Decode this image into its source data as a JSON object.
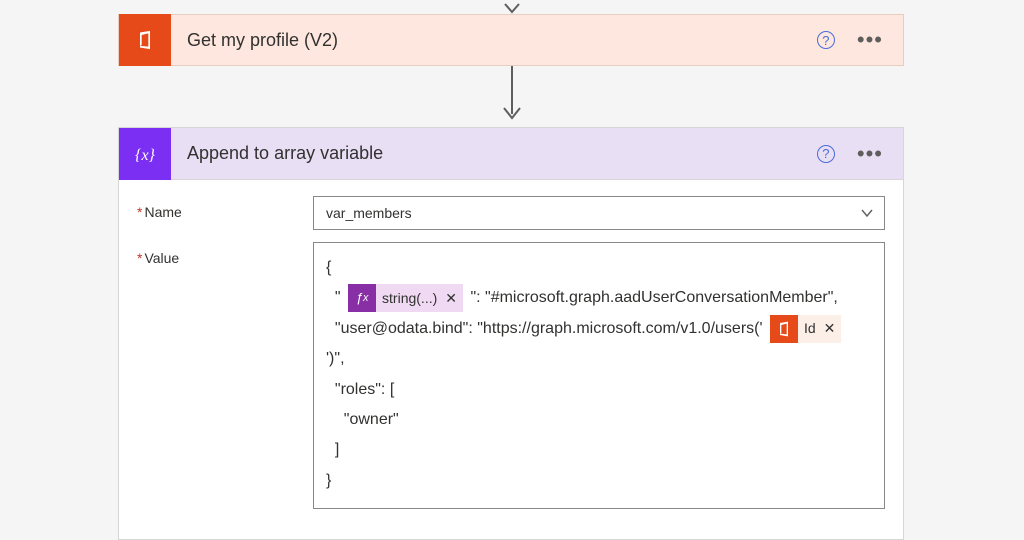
{
  "step1": {
    "title": "Get my profile (V2)",
    "help_tooltip": "?",
    "more_label": "..."
  },
  "step2": {
    "title": "Append to array variable",
    "help_tooltip": "?",
    "more_label": "...",
    "fields": {
      "name": {
        "label": "Name",
        "value": "var_members"
      },
      "value": {
        "label": "Value"
      }
    },
    "value_body": {
      "line1_open": "{",
      "line2_prefix": "  \"",
      "fx_token": "string(...)",
      "line2_mid": "\": \"#microsoft.graph.aadUserConversationMember\",",
      "line3_prefix": "  \"user@odata.bind\": \"https://graph.microsoft.com/v1.0/users('",
      "id_token": "Id",
      "line4": "')\",",
      "line5": "  \"roles\": [",
      "line6": "    \"owner\"",
      "line7": "  ]",
      "line8": "}"
    }
  }
}
